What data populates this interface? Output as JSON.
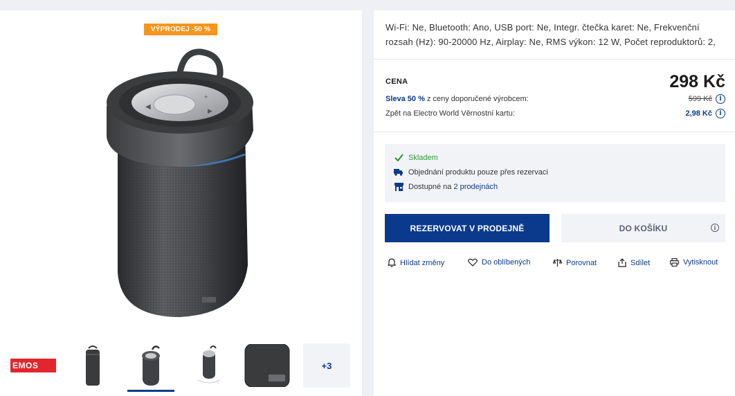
{
  "product": {
    "sale_badge": "VÝPRODEJ -50 %",
    "specs_text": "Wi-Fi: Ne, Bluetooth: Ano, USB port: Ne, Integr. čtečka karet: Ne, Frekvenční rozsah (Hz): 90-20000 Hz, Airplay: Ne, RMS výkon: 12 W, Počet reproduktorů: 2,"
  },
  "gallery": {
    "brand_logo_text": "EMOS",
    "more_label": "+3"
  },
  "pricing": {
    "label": "CENA",
    "price": "298 Kč",
    "discount_highlight": "Sleva 50 %",
    "discount_text": " z ceny doporučené výrobcem:",
    "original_price": "599 Kč",
    "loyalty_text": "Zpět na Electro World Věrnostní kartu:",
    "loyalty_value": "2,98 Kč"
  },
  "availability": {
    "stock": "Skladem",
    "reservation_note": "Objednání produktu pouze přes rezervaci",
    "stores_prefix": "Dostupné na ",
    "stores_link": "2 prodejnách"
  },
  "buttons": {
    "reserve": "REZERVOVAT V PRODEJNĚ",
    "cart": "DO KOŠÍKU"
  },
  "actions": {
    "watch": "Hlídat změny",
    "favorite": "Do oblíbených",
    "compare": "Porovnat",
    "share": "Sdílet",
    "print": "Vytisknout"
  },
  "colors": {
    "brand_blue": "#0b3a8c",
    "sale_orange": "#f7941d",
    "stock_green": "#2e9a3a",
    "emos_red": "#e3262d"
  }
}
